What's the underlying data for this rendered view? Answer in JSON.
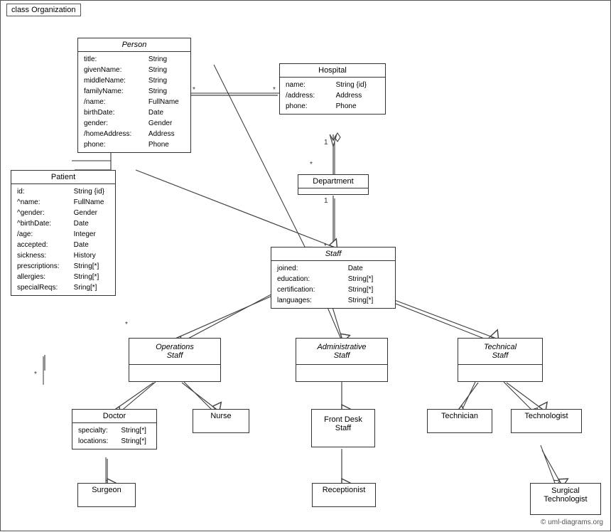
{
  "diagram": {
    "title": "class Organization",
    "classes": {
      "person": {
        "name": "Person",
        "italic": true,
        "attributes": [
          [
            "title:",
            "String"
          ],
          [
            "givenName:",
            "String"
          ],
          [
            "middleName:",
            "String"
          ],
          [
            "familyName:",
            "String"
          ],
          [
            "/name:",
            "FullName"
          ],
          [
            "birthDate:",
            "Date"
          ],
          [
            "gender:",
            "Gender"
          ],
          [
            "/homeAddress:",
            "Address"
          ],
          [
            "phone:",
            "Phone"
          ]
        ]
      },
      "hospital": {
        "name": "Hospital",
        "italic": false,
        "attributes": [
          [
            "name:",
            "String {id}"
          ],
          [
            "/address:",
            "Address"
          ],
          [
            "phone:",
            "Phone"
          ]
        ]
      },
      "department": {
        "name": "Department",
        "italic": false,
        "attributes": []
      },
      "staff": {
        "name": "Staff",
        "italic": true,
        "attributes": [
          [
            "joined:",
            "Date"
          ],
          [
            "education:",
            "String[*]"
          ],
          [
            "certification:",
            "String[*]"
          ],
          [
            "languages:",
            "String[*]"
          ]
        ]
      },
      "patient": {
        "name": "Patient",
        "italic": false,
        "attributes": [
          [
            "id:",
            "String {id}"
          ],
          [
            "^name:",
            "FullName"
          ],
          [
            "^gender:",
            "Gender"
          ],
          [
            "^birthDate:",
            "Date"
          ],
          [
            "/age:",
            "Integer"
          ],
          [
            "accepted:",
            "Date"
          ],
          [
            "sickness:",
            "History"
          ],
          [
            "prescriptions:",
            "String[*]"
          ],
          [
            "allergies:",
            "String[*]"
          ],
          [
            "specialReqs:",
            "Sring[*]"
          ]
        ]
      },
      "operations_staff": {
        "name": "Operations Staff",
        "italic": true
      },
      "administrative_staff": {
        "name": "Administrative Staff",
        "italic": true
      },
      "technical_staff": {
        "name": "Technical Staff",
        "italic": true
      },
      "doctor": {
        "name": "Doctor",
        "italic": false,
        "attributes": [
          [
            "specialty:",
            "String[*]"
          ],
          [
            "locations:",
            "String[*]"
          ]
        ]
      },
      "nurse": {
        "name": "Nurse",
        "italic": false,
        "attributes": []
      },
      "front_desk_staff": {
        "name": "Front Desk Staff",
        "italic": false,
        "attributes": []
      },
      "technician": {
        "name": "Technician",
        "italic": false,
        "attributes": []
      },
      "technologist": {
        "name": "Technologist",
        "italic": false,
        "attributes": []
      },
      "surgeon": {
        "name": "Surgeon",
        "italic": false,
        "attributes": []
      },
      "receptionist": {
        "name": "Receptionist",
        "italic": false,
        "attributes": []
      },
      "surgical_technologist": {
        "name": "Surgical Technologist",
        "italic": false,
        "attributes": []
      }
    },
    "copyright": "© uml-diagrams.org"
  }
}
